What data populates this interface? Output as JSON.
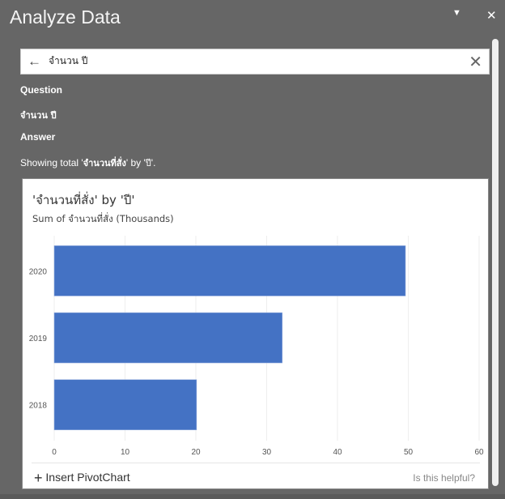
{
  "panel": {
    "title": "Analyze Data",
    "menu_icon": "caret-down-icon",
    "close_icon": "close-icon"
  },
  "search": {
    "value": "จำนวน ปี",
    "back_icon": "arrow-left-icon",
    "clear_icon": "clear-icon"
  },
  "question_label": "Question",
  "question_text": "จำนวน ปี",
  "answer_label": "Answer",
  "answer_prefix": "Showing total '",
  "answer_field": "จำนวนที่สั่ง",
  "answer_mid": "' by '",
  "answer_by": "ปี",
  "answer_suffix": "'.",
  "card": {
    "insert_label": "Insert PivotChart",
    "helpful_label": "Is this helpful?"
  },
  "colors": {
    "bar": "#4472c4",
    "panel": "#666666"
  },
  "chart_data": {
    "type": "bar",
    "orientation": "horizontal",
    "title": "'จำนวนที่สั่ง' by 'ปี'",
    "subtitle": "Sum of จำนวนที่สั่ง (Thousands)",
    "categories": [
      "2020",
      "2019",
      "2018"
    ],
    "values": [
      49.6,
      32.2,
      20.1
    ],
    "xlim": [
      0,
      60
    ],
    "xticks": [
      "0",
      "10",
      "20",
      "30",
      "40",
      "50",
      "60"
    ],
    "grid": true,
    "legend": "none"
  }
}
